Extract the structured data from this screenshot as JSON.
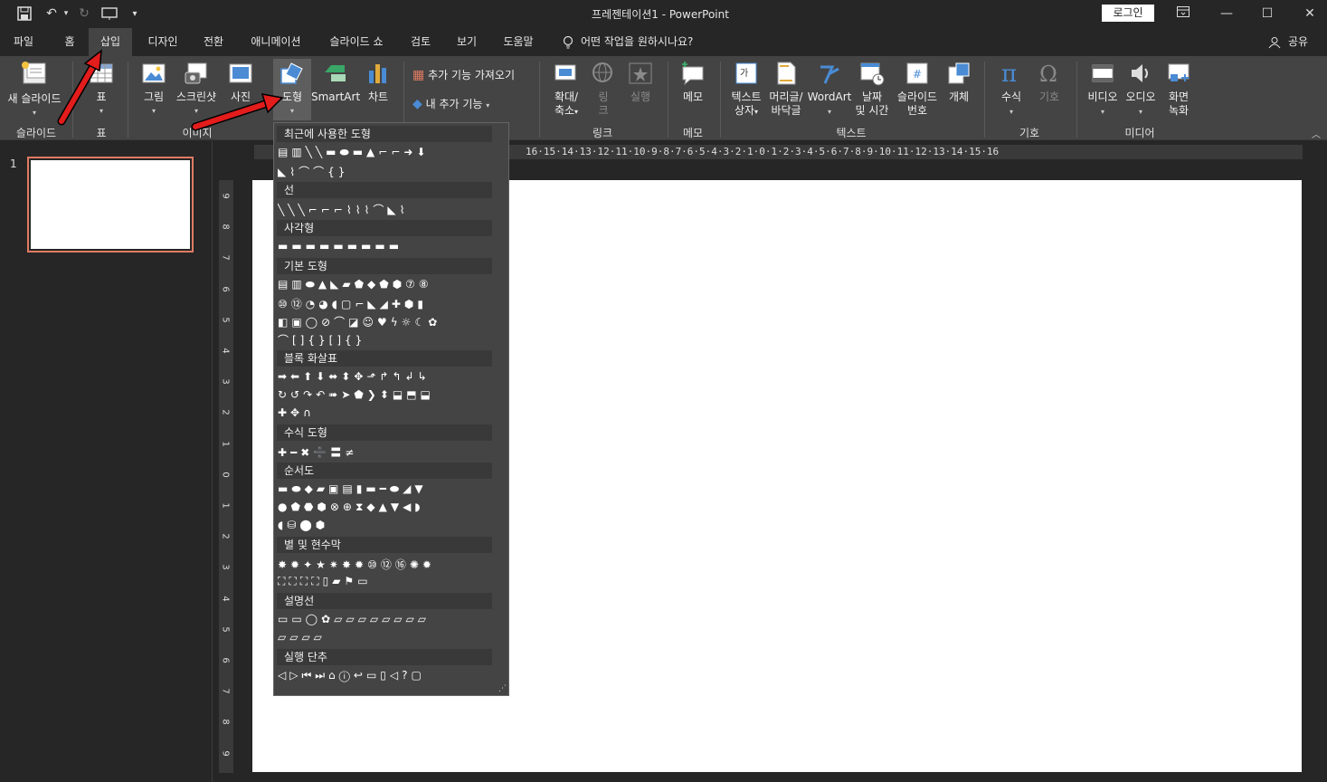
{
  "titlebar": {
    "doc_title": "프레젠테이션1  -  PowerPoint",
    "login": "로그인"
  },
  "tabs": [
    "파일",
    "홈",
    "삽입",
    "디자인",
    "전환",
    "애니메이션",
    "슬라이드 쇼",
    "검토",
    "보기",
    "도움말"
  ],
  "tell_me": "어떤 작업을 원하시나요?",
  "share": "공유",
  "ribbon": {
    "new_slide": "새 슬라이드",
    "table": "표",
    "picture": "그림",
    "screenshot": "스크린샷",
    "photo": "사진",
    "shapes": "도형",
    "smartart": "SmartArt",
    "chart": "차트",
    "get_addins": "추가 기능 가져오기",
    "my_addins": "내 추가 기능",
    "zoom_l1": "확대/",
    "zoom_l2": "축소",
    "link_l1": "링",
    "link_l2": "크",
    "action": "실행",
    "comment": "메모",
    "textbox_l1": "텍스트",
    "textbox_l2": "상자",
    "header_l1": "머리글/",
    "header_l2": "바닥글",
    "wordart": "WordArt",
    "date_l1": "날짜",
    "date_l2": "및 시간",
    "slidenum_l1": "슬라이드",
    "slidenum_l2": "번호",
    "object": "개체",
    "equation": "수식",
    "symbol": "기호",
    "video": "비디오",
    "audio": "오디오",
    "rec_l1": "화면",
    "rec_l2": "녹화",
    "groups": {
      "slides": "슬라이드",
      "tables": "표",
      "images": "이미지",
      "links": "링크",
      "comments": "메모",
      "text": "텍스트",
      "symbols": "기호",
      "media": "미디어"
    }
  },
  "thumbs": {
    "slide_number": "1"
  },
  "gallery": {
    "sections": [
      "최근에 사용한 도형",
      "선",
      "사각형",
      "기본 도형",
      "블록 화살표",
      "수식 도형",
      "순서도",
      "별 및 현수막",
      "설명선",
      "실행 단추"
    ]
  },
  "ruler": {
    "h": "16·15·14·13·12·11·10·9·8·7·6·5·4·3·2·1·0·1·2·3·4·5·6·7·8·9·10·11·12·13·14·15·16",
    "v": [
      "9",
      "8",
      "7",
      "6",
      "5",
      "4",
      "3",
      "2",
      "1",
      "0",
      "1",
      "2",
      "3",
      "4",
      "5",
      "6",
      "7",
      "8",
      "9"
    ]
  },
  "colors": {
    "accent": "#e07b62",
    "ribbon": "#444444",
    "bg": "#262626",
    "annotation_arrow": "#e31c1c"
  }
}
